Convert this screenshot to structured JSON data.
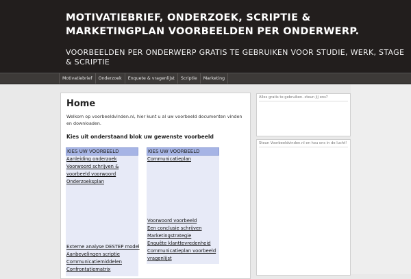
{
  "header": {
    "title": "MOTIVATIEBRIEF, ONDERZOEK, SCRIPTIE & MARKETINGPLAN VOORBEELDEN PER ONDERWERP.",
    "description": "VOORBEELDEN PER ONDERWERP GRATIS TE GEBRUIKEN VOOR STUDIE, WERK, STAGE & SCRIPTIE"
  },
  "nav": {
    "items": [
      "Motivatiebrief",
      "Onderzoek",
      "Enquete & vragenlijst",
      "Scriptie",
      "Marketing"
    ]
  },
  "main": {
    "title": "Home",
    "intro": "Welkom op voorbeeldvinden.nl, hier kunt u al uw voorbeeld documenten vinden en downloaden.",
    "subheading": "Kies uit onderstaand blok uw gewenste voorbeeld",
    "left_column": {
      "caption": "KIES UW VOORBEELD",
      "top_items": [
        "Aanleiding onderzoek",
        "Voorwoord schrijven & voorbeeld voorwoord",
        "Onderzoeksplan"
      ],
      "bottom_items": [
        "Externe analyse DESTEP model",
        "Aanbevelingen scriptie",
        "Communicatiemiddelen",
        "Confrontatiematrix"
      ]
    },
    "right_column": {
      "caption": "KIES UW VOORBEELD",
      "top_items": [
        "Communicatieplan"
      ],
      "bottom_items": [
        "Voorwoord voorbeeld",
        "Een conclusie schrijven",
        "Marketingstrategie",
        "Enquête klanttevredenheid",
        "Communicatieplan voorbeeld vragenlijst"
      ]
    }
  },
  "sidebar": {
    "widget1_title": "Alles gratis te gebruiken. steun jij ons?",
    "widget2_title": "Steun Voorbeeldvinden.nl en hou ons in de lucht!"
  }
}
